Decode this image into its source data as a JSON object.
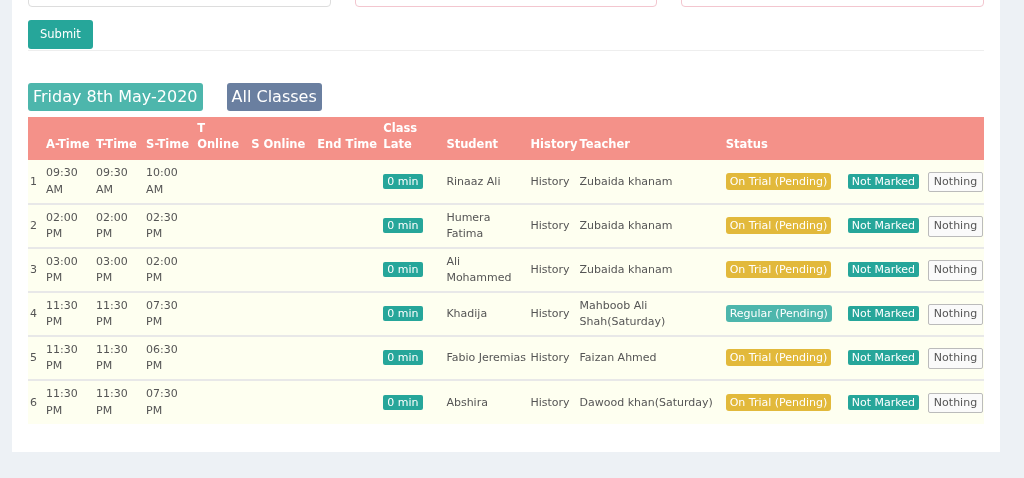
{
  "filter_fields": [
    {
      "invalid": false
    },
    {
      "invalid": true
    },
    {
      "invalid": true
    }
  ],
  "submit": "Submit",
  "date_badge": "Friday 8th May-2020",
  "class_badge": "All Classes",
  "table": {
    "columns": [
      "",
      "A-Time",
      "T-Time",
      "S-Time",
      "T Online",
      "S Online",
      "End Time",
      "Class Late",
      "Student",
      "History",
      "Teacher",
      "Status",
      "",
      ""
    ],
    "rows": [
      {
        "index": "1",
        "a_time": "09:30 AM",
        "t_time": "09:30 AM",
        "s_time": "10:00 AM",
        "late": "0 min",
        "student": "Rinaaz Ali",
        "subject": "History",
        "teacher": "Zubaida khanam",
        "status": {
          "text": "On Trial (Pending)",
          "kind": "trial"
        },
        "marked": "Not Marked",
        "action": "Nothing"
      },
      {
        "index": "2",
        "a_time": "02:00 PM",
        "t_time": "02:00 PM",
        "s_time": "02:30 PM",
        "late": "0 min",
        "student": "Humera Fatima",
        "subject": "History",
        "teacher": "Zubaida khanam",
        "status": {
          "text": "On Trial (Pending)",
          "kind": "trial"
        },
        "marked": "Not Marked",
        "action": "Nothing"
      },
      {
        "index": "3",
        "a_time": "03:00 PM",
        "t_time": "03:00 PM",
        "s_time": "02:00 PM",
        "late": "0 min",
        "student": "Ali Mohammed",
        "subject": "History",
        "teacher": "Zubaida khanam",
        "status": {
          "text": "On Trial (Pending)",
          "kind": "trial"
        },
        "marked": "Not Marked",
        "action": "Nothing"
      },
      {
        "index": "4",
        "a_time": "11:30 PM",
        "t_time": "11:30 PM",
        "s_time": "07:30 PM",
        "late": "0 min",
        "student": "Khadija",
        "subject": "History",
        "teacher": "Mahboob Ali Shah(Saturday)",
        "status": {
          "text": "Regular (Pending)",
          "kind": "regular"
        },
        "marked": "Not Marked",
        "action": "Nothing"
      },
      {
        "index": "5",
        "a_time": "11:30 PM",
        "t_time": "11:30 PM",
        "s_time": "06:30 PM",
        "late": "0 min",
        "student": "Fabio Jeremias",
        "subject": "History",
        "teacher": "Faizan Ahmed",
        "status": {
          "text": "On Trial (Pending)",
          "kind": "trial"
        },
        "marked": "Not Marked",
        "action": "Nothing"
      },
      {
        "index": "6",
        "a_time": "11:30 PM",
        "t_time": "11:30 PM",
        "s_time": "07:30 PM",
        "late": "0 min",
        "student": "Abshira",
        "subject": "History",
        "teacher": "Dawood khan(Saturday)",
        "status": {
          "text": "On Trial (Pending)",
          "kind": "trial"
        },
        "marked": "Not Marked",
        "action": "Nothing"
      }
    ]
  }
}
